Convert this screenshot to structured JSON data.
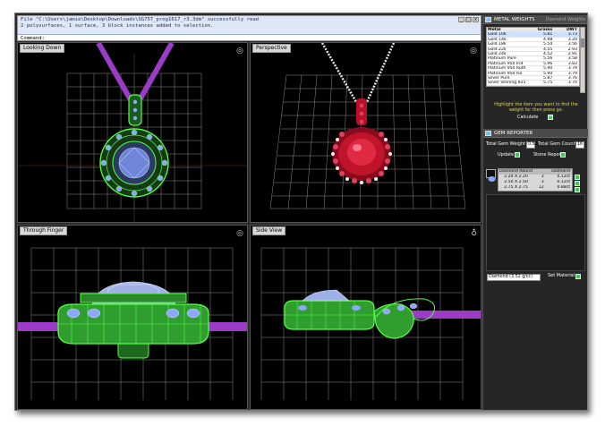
{
  "command": {
    "history": [
      "File \"C:\\Users\\jamie\\Desktop\\Downloads\\SG757_prog1617_r3.3dm\" successfully read",
      "2 polysurfaces, 1 surface, 3 block instances added to selection."
    ],
    "prompt": "Command:",
    "controls": [
      "_",
      "□",
      "x"
    ]
  },
  "viewports": [
    {
      "title": "Looking Down"
    },
    {
      "title": "Perspective"
    },
    {
      "title": "Through Finger"
    },
    {
      "title": "Side View"
    }
  ],
  "metal_weights": {
    "title": "METAL WEIGHTS",
    "secondary_tab": "Diamond Weights",
    "columns": [
      "Metal",
      "Grams",
      "DWT"
    ],
    "rows": [
      [
        "Gold 10k",
        "5.81",
        "3.73"
      ],
      [
        "Gold 14k",
        "4.98",
        "3.20"
      ],
      [
        "Gold 18k",
        "5.54",
        "3.56"
      ],
      [
        "Gold 22k",
        "4.55",
        "2.93"
      ],
      [
        "Gold 24k",
        "4.52",
        "2.91"
      ],
      [
        "Platinum Pure",
        "5.56",
        "3.58"
      ],
      [
        "Platinum 950 Irid",
        "5.96",
        "3.83"
      ],
      [
        "Platinum 950 Ruth",
        "5.90",
        "3.79"
      ],
      [
        "Platinum 950 Iso",
        "5.90",
        "3.79"
      ],
      [
        "Silver Pure",
        "5.87",
        "3.76"
      ],
      [
        "Silver Sterling 925",
        "5.75",
        "3.70"
      ]
    ],
    "note": "Highlight the item you want to find the weight for then press go.",
    "calculate_label": "Calculate",
    "go_label": ">"
  },
  "gem_reporter": {
    "title": "GEM REPORTER",
    "total_weight_label": "Total Gem Weight",
    "total_weight_value": "0.52",
    "total_count_label": "Total Gem Count",
    "total_count_value": "16",
    "update_label": "Update",
    "stone_report_label": "Stone Report",
    "columns": [
      "Diamond Round",
      "",
      "Diamond"
    ],
    "rows": [
      [
        "2.20 X 2.20",
        "3",
        "0.12ct"
      ],
      [
        "2.50 X 2.50",
        "3",
        "0.12ct"
      ],
      [
        "2.75 X 2.75",
        "12",
        "0.88ct"
      ]
    ],
    "material_value": "Diamond      (3.52 g/cc)",
    "set_material_label": "Set Material"
  },
  "colors": {
    "grid": "#8c8c8c",
    "wire_green": "#55ff44",
    "gem_blue": "#8fa8ff",
    "chain_purple": "#9b3bc8",
    "ruby": "#c0142a",
    "panel_dark": "#262626",
    "accent_yellow": "#e8d830"
  }
}
